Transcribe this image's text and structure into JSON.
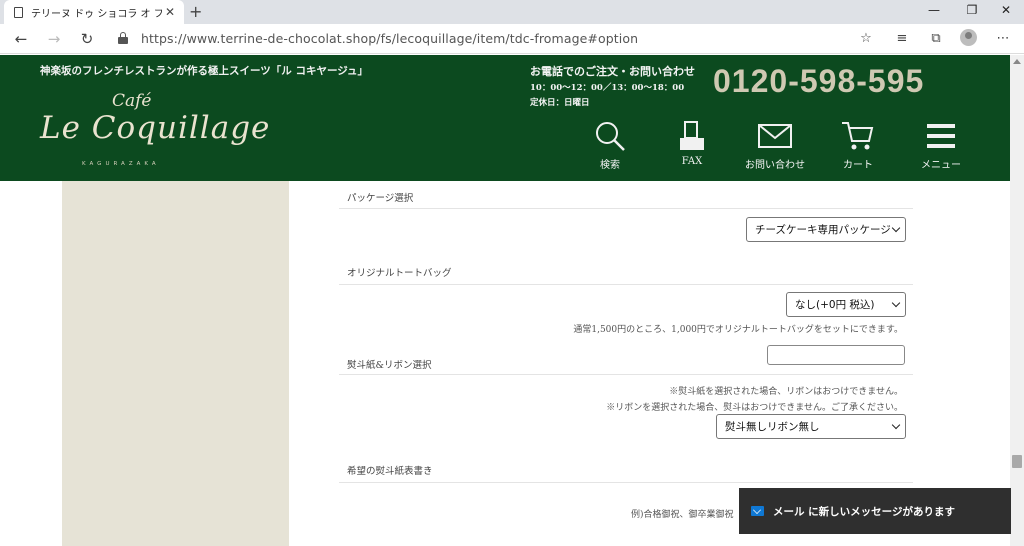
{
  "browser": {
    "tab_title": "テリーヌ ドゥ ショコラ オ フロマージュ 窯",
    "tab_close": "✕",
    "new_tab": "+",
    "url": "https://www.terrine-de-chocolat.shop/fs/lecoquillage/item/tdc-fromage#option",
    "win_minimize": "—",
    "win_restore": "❐",
    "win_close": "✕"
  },
  "header": {
    "tagline": "神楽坂のフレンチレストランが作る極上スイーツ「ル コキヤージュ」",
    "logo_cafe": "Café",
    "logo_main": "Le Coquillage",
    "logo_sub": "KAGURAZAKA",
    "tel_heading": "お電話でのご注文・お問い合わせ",
    "tel_hours": "10：00〜12：00／13：00〜18：00",
    "tel_closed": "定休日：日曜日",
    "tel_number": "0120-598-595",
    "nav": {
      "search": "検索",
      "fax": "FAX",
      "contact": "お問い合わせ",
      "cart": "カート",
      "menu": "メニュー"
    }
  },
  "options": {
    "package_label": "パッケージ選択",
    "package_value": "チーズケーキ専用パッケージ",
    "tote_label": "オリジナルトートバッグ",
    "tote_value": "なし(+0円 税込)",
    "tote_note": "通常1,500円のところ、1,000円でオリジナルトートバッグをセットにできます。",
    "noshi_label": "熨斗紙&リボン選択",
    "noshi_note1": "※熨斗紙を選択された場合、リボンはおつけできません。",
    "noshi_note2": "※リボンを選択された場合、熨斗はおつけできません。ご了承ください。",
    "noshi_value": "熨斗無しリボン無し",
    "noshi_text_label": "希望の熨斗紙表書き",
    "noshi_text_example": "例)合格御祝、御卒業御祝"
  },
  "toast": {
    "message": "メール に新しいメッセージがあります"
  }
}
